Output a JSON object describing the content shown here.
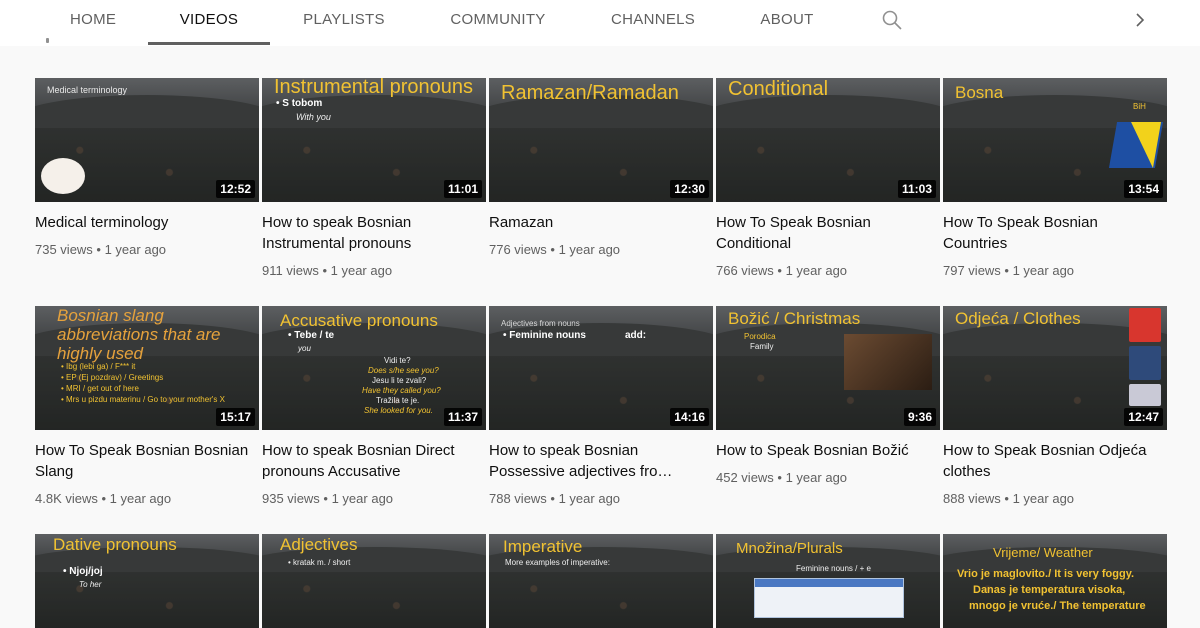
{
  "tabs": [
    {
      "label": "HOME",
      "active": false
    },
    {
      "label": "VIDEOS",
      "active": true
    },
    {
      "label": "PLAYLISTS",
      "active": false
    },
    {
      "label": "COMMUNITY",
      "active": false
    },
    {
      "label": "CHANNELS",
      "active": false
    },
    {
      "label": "ABOUT",
      "active": false
    }
  ],
  "icons": {
    "search": "search-icon",
    "next": "chevron-right-icon"
  },
  "colors": {
    "thumb_title": "#f1c232",
    "active_tab": "#0f0f0f",
    "inactive_tab": "#606060",
    "meta": "#606060"
  },
  "videos": [
    {
      "thumb_title": "Medical terminology",
      "duration": "12:52",
      "title": "Medical terminology",
      "views": "735 views",
      "age": "1 year ago"
    },
    {
      "thumb_title": "Instrumental pronouns",
      "thumb_lines": [
        "• S tobom",
        "With you"
      ],
      "duration": "11:01",
      "title": "How to speak Bosnian Instrumental pronouns",
      "views": "911 views",
      "age": "1 year ago"
    },
    {
      "thumb_title": "Ramazan/Ramadan",
      "duration": "12:30",
      "title": "Ramazan",
      "views": "776 views",
      "age": "1 year ago"
    },
    {
      "thumb_title": "Conditional",
      "duration": "11:03",
      "title": "How To Speak Bosnian Conditional",
      "views": "766 views",
      "age": "1 year ago"
    },
    {
      "thumb_title": "Bosna",
      "thumb_lines": [
        "BiH"
      ],
      "duration": "13:54",
      "title": "How To Speak Bosnian Countries",
      "views": "797 views",
      "age": "1 year ago"
    },
    {
      "thumb_title": "Bosnian slang abbreviations that are highly used",
      "thumb_lines": [
        "• Ibg (lebi ga) / F*** it",
        "• EP (Ej pozdrav) / Greetings",
        "• MRI / get out of here",
        "• Mrs u pizdu materinu / Go to your mother's X"
      ],
      "duration": "15:17",
      "title": "How To Speak Bosnian Bosnian Slang",
      "views": "4.8K views",
      "age": "1 year ago"
    },
    {
      "thumb_title": "Accusative pronouns",
      "thumb_lines": [
        "• Tebe / te",
        "you",
        "Vidi te?",
        "Does s/he see you?",
        "Jesu li te zvali?",
        "Have they called you?",
        "Tražila te je.",
        "She looked for you."
      ],
      "duration": "11:37",
      "title": "How to speak Bosnian Direct pronouns Accusative",
      "views": "935 views",
      "age": "1 year ago"
    },
    {
      "thumb_title": "Adjectives from nouns",
      "thumb_lines": [
        "• Feminine nouns",
        "add:"
      ],
      "duration": "14:16",
      "title": "How to speak Bosnian Possessive adjectives fro…",
      "views": "788 views",
      "age": "1 year ago"
    },
    {
      "thumb_title": "Božić / Christmas",
      "thumb_lines": [
        "Porodica",
        "Family"
      ],
      "duration": "9:36",
      "title": "How to Speak Bosnian Božić",
      "views": "452 views",
      "age": "1 year ago"
    },
    {
      "thumb_title": "Odjeća / Clothes",
      "duration": "12:47",
      "title": "How to Speak Bosnian Odjeća clothes",
      "views": "888 views",
      "age": "1 year ago"
    },
    {
      "thumb_title": "Dative pronouns",
      "thumb_lines": [
        "• Njoj/joj",
        "To her"
      ]
    },
    {
      "thumb_title": "Adjectives",
      "thumb_lines": [
        "• kratak m. / short"
      ]
    },
    {
      "thumb_title": "Imperative",
      "thumb_lines": [
        "More examples of imperative:"
      ]
    },
    {
      "thumb_title": "Množina/Plurals",
      "thumb_lines": [
        "Feminine nouns / + e"
      ]
    },
    {
      "thumb_title": "Vrijeme/ Weather",
      "thumb_lines": [
        "Vrio je maglovito./ It is very foggy.",
        "Danas je temperatura visoka,",
        "mnogo je vruće./ The temperature"
      ]
    }
  ]
}
